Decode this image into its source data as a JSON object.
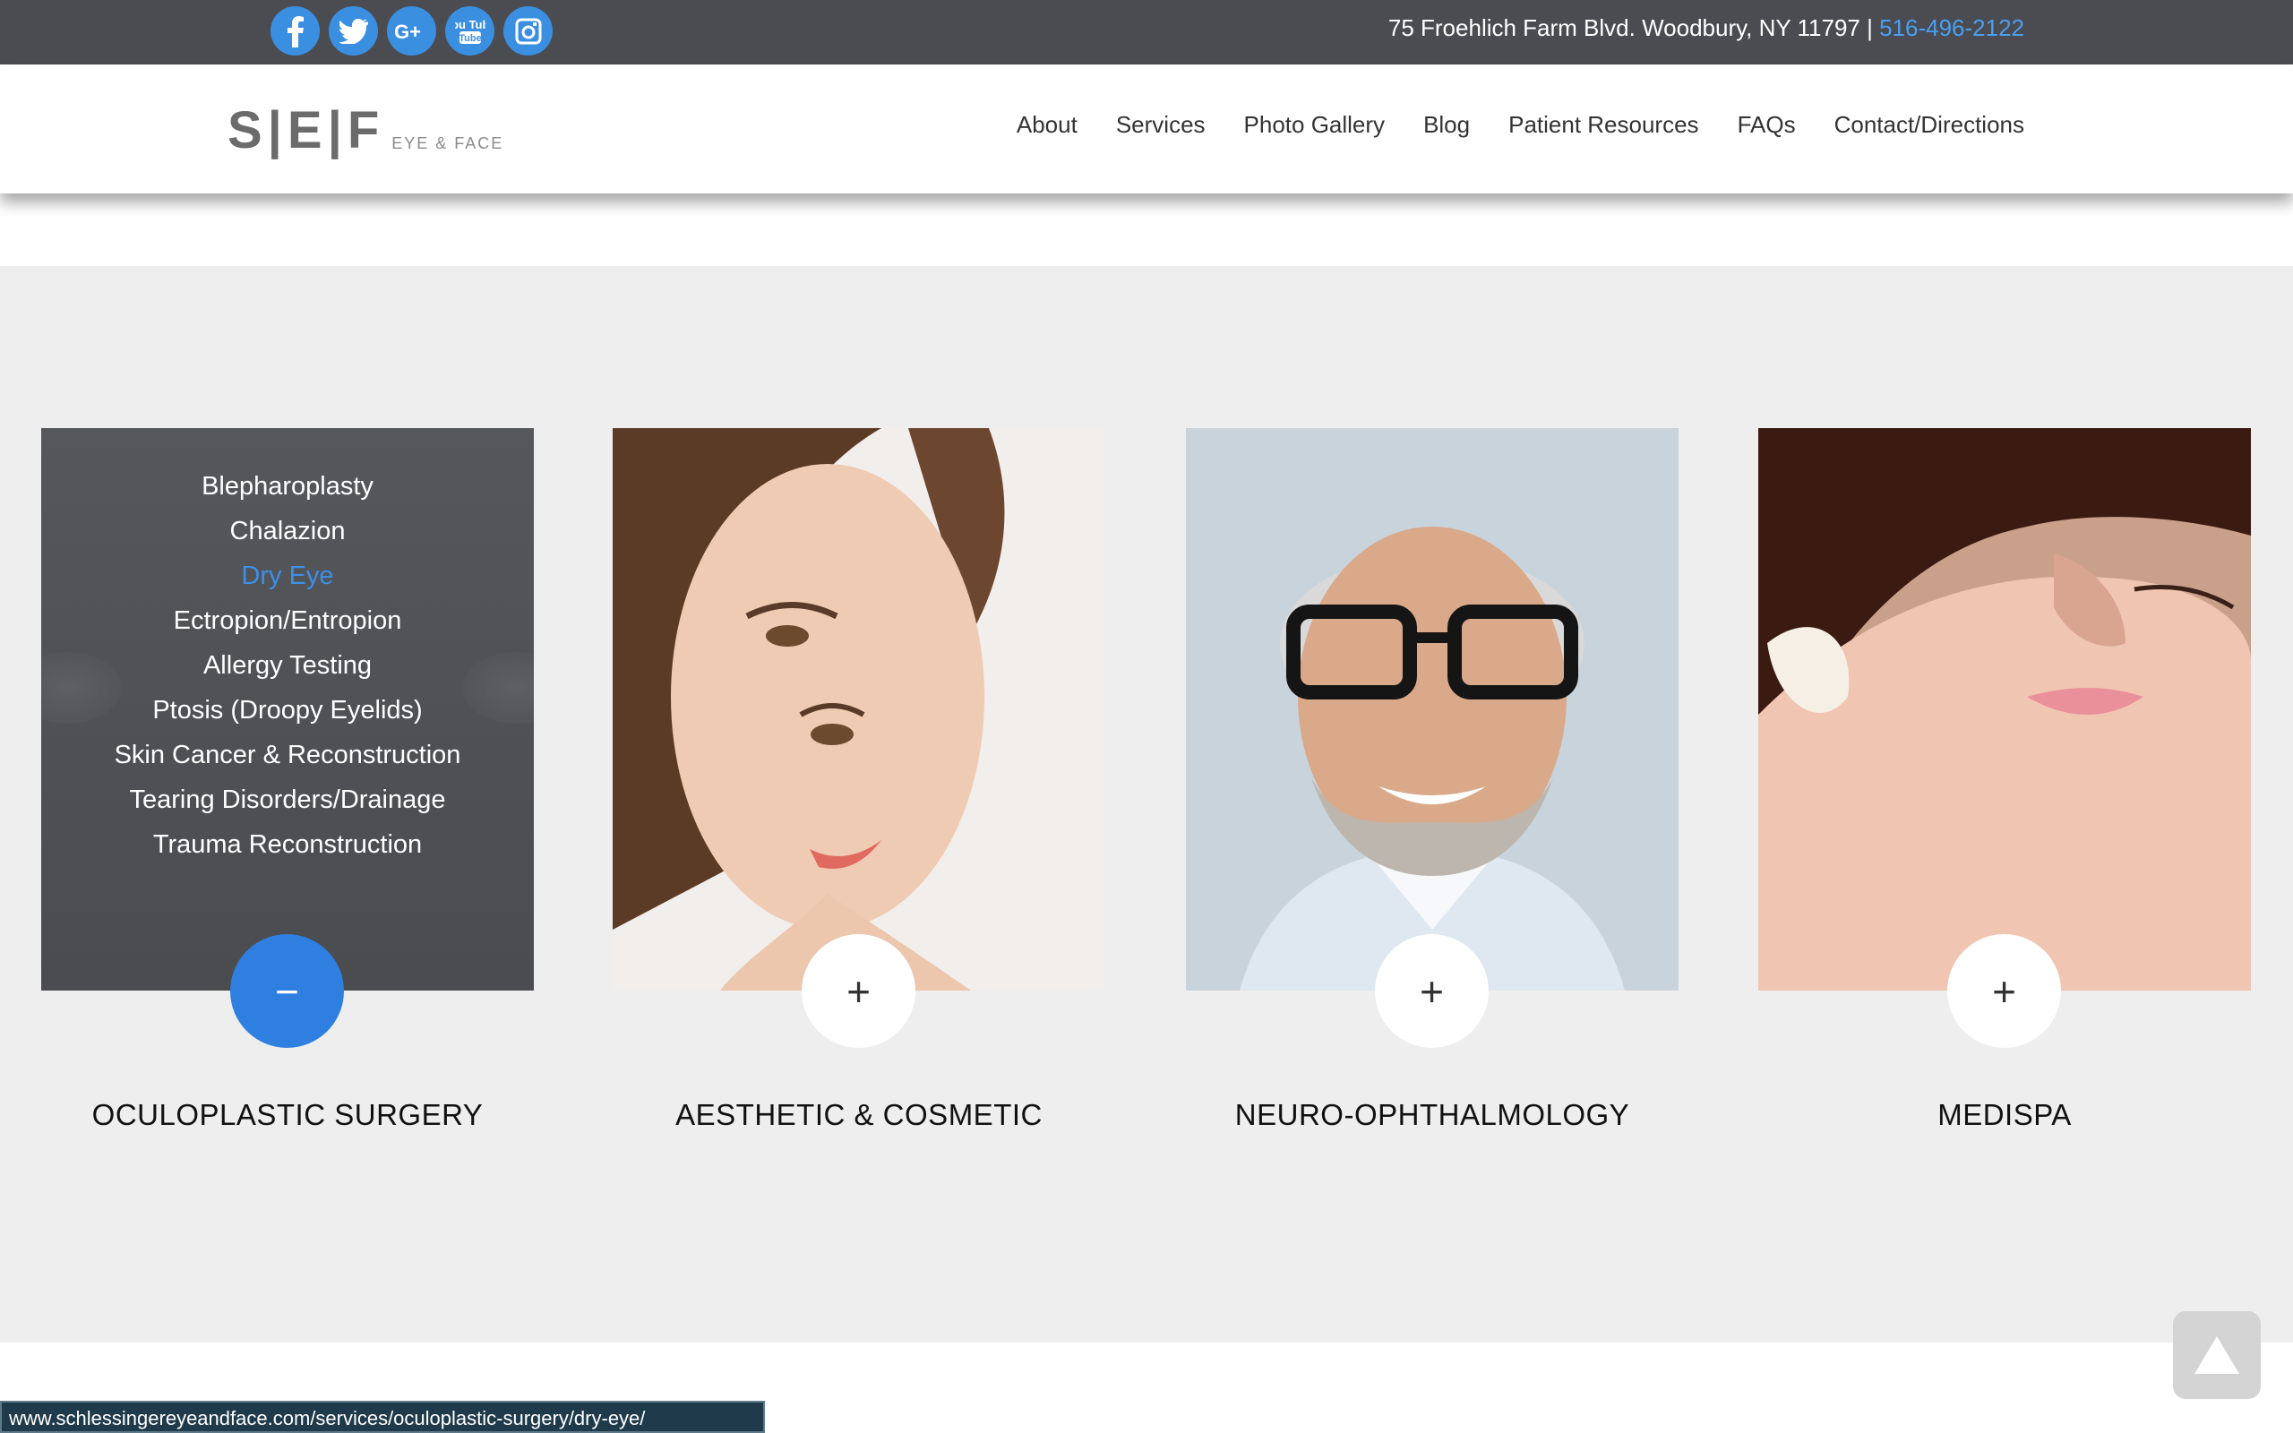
{
  "topbar": {
    "social_icons": [
      "facebook-icon",
      "twitter-icon",
      "google-plus-icon",
      "youtube-icon",
      "instagram-icon"
    ],
    "youtube_text": "You Tube",
    "address": "75 Froehlich Farm Blvd. Woodbury, NY 11797 | ",
    "phone": "516-496-2122"
  },
  "header": {
    "logo_mark": "S|E|F",
    "logo_sub": "EYE & FACE",
    "nav": [
      "About",
      "Services",
      "Photo Gallery",
      "Blog",
      "Patient Resources",
      "FAQs",
      "Contact/Directions"
    ]
  },
  "cards": [
    {
      "title": "OCULOPLASTIC SURGERY",
      "toggle": "−",
      "expanded": true,
      "menu": [
        "Blepharoplasty",
        "Chalazion",
        "Dry Eye",
        "Ectropion/Entropion",
        "Allergy Testing",
        "Ptosis (Droopy Eyelids)",
        "Skin Cancer & Reconstruction",
        "Tearing Disorders/Drainage",
        "Trauma Reconstruction"
      ],
      "active_item": "Dry Eye"
    },
    {
      "title": "AESTHETIC & COSMETIC",
      "toggle": "+",
      "expanded": false
    },
    {
      "title": "NEURO-OPHTHALMOLOGY",
      "toggle": "+",
      "expanded": false
    },
    {
      "title": "MEDISPA",
      "toggle": "+",
      "expanded": false
    }
  ],
  "status_url": "www.schlessingereyeandface.com/services/oculoplastic-surgery/dry-eye/",
  "colors": {
    "accent": "#2f7fe0",
    "topbar": "#4a4c52",
    "link": "#4a9ff0",
    "section_bg": "#eeeeee"
  }
}
